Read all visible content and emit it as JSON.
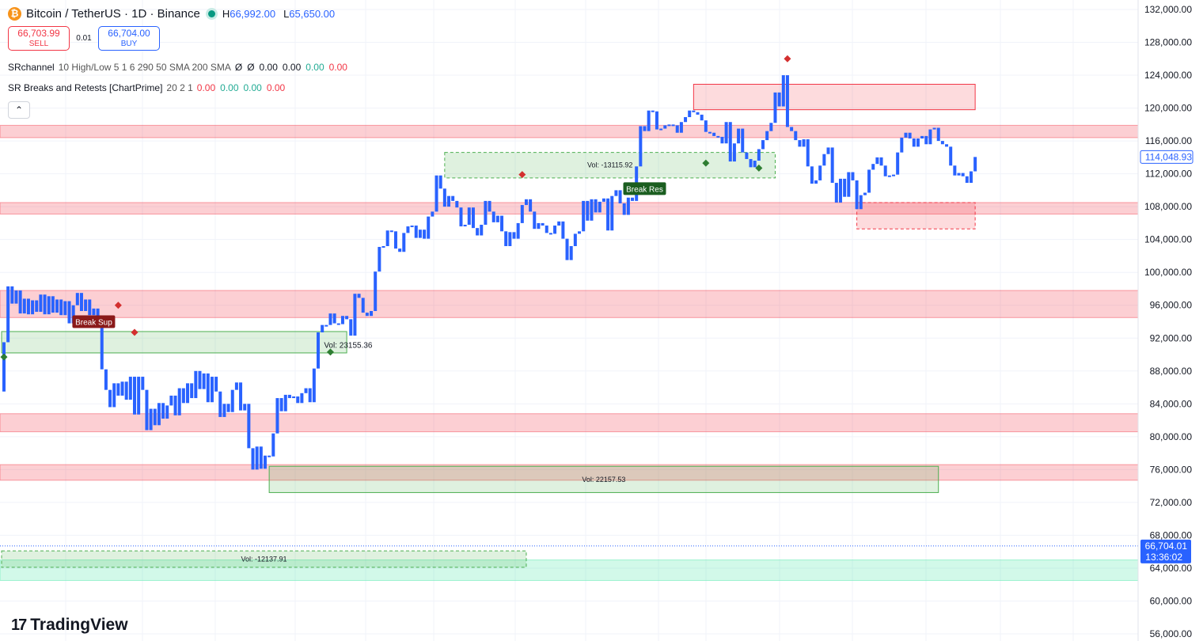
{
  "header": {
    "symbol_icon": "bitcoin-icon",
    "symbol_icon_text": "₿",
    "title": "Bitcoin / TetherUS · 1D · Binance",
    "high_label": "H",
    "high_value": "66,992.00",
    "low_label": "L",
    "low_value": "65,650.00"
  },
  "trade": {
    "sell_price": "66,703.99",
    "sell_label": "SELL",
    "spread": "0.01",
    "buy_price": "66,704.00",
    "buy_label": "BUY"
  },
  "indicators": [
    {
      "name": "SRchannel",
      "params": "10 High/Low 5 1 6 290 50 SMA 200 SMA",
      "values": [
        {
          "text": "Ø",
          "color": "#131722"
        },
        {
          "text": "Ø",
          "color": "#131722"
        },
        {
          "text": "0.00",
          "color": "#131722"
        },
        {
          "text": "0.00",
          "color": "#131722"
        },
        {
          "text": "0.00",
          "color": "#22ab94"
        },
        {
          "text": "0.00",
          "color": "#f23645"
        }
      ]
    },
    {
      "name": "SR Breaks and Retests [ChartPrime]",
      "params": "20 2 1",
      "values": [
        {
          "text": "0.00",
          "color": "#f23645"
        },
        {
          "text": "0.00",
          "color": "#22ab94"
        },
        {
          "text": "0.00",
          "color": "#22ab94"
        },
        {
          "text": "0.00",
          "color": "#f23645"
        }
      ]
    }
  ],
  "collapse_icon": "chevron-up-icon",
  "logo": {
    "mark": "17",
    "text": "TradingView"
  },
  "chart_data": {
    "type": "bar",
    "title": "Bitcoin / TetherUS · 1D · Binance",
    "bar_color": "#2962ff",
    "y_axis": {
      "ticks": [
        "132,000.00",
        "128,000.00",
        "124,000.00",
        "120,000.00",
        "116,000.00",
        "112,000.00",
        "108,000.00",
        "104,000.00",
        "100,000.00",
        "96,000.00",
        "92,000.00",
        "88,000.00",
        "84,000.00",
        "80,000.00",
        "76,000.00",
        "72,000.00",
        "68,000.00",
        "64,000.00",
        "60,000.00",
        "56,000.00"
      ],
      "ylim": [
        56000,
        132000
      ]
    },
    "last_price_label": "114,048.93",
    "current_price_label": "66,704.01",
    "countdown": "13:36:02",
    "current_price": 66704,
    "sr_zones": [
      {
        "from": 116400,
        "to": 117900,
        "color": "#f23645"
      },
      {
        "from": 107100,
        "to": 108500,
        "color": "#f23645"
      },
      {
        "from": 94500,
        "to": 97800,
        "color": "#f23645"
      },
      {
        "from": 80600,
        "to": 82800,
        "color": "#f23645"
      },
      {
        "from": 74700,
        "to": 76600,
        "color": "#f23645"
      },
      {
        "from": 62500,
        "to": 65000,
        "color": "#42e6a4"
      }
    ],
    "retest_boxes": [
      {
        "bar_from": 0,
        "bar_to": 84,
        "from": 90200,
        "to": 92800,
        "style": "solid",
        "fill": "#4caf50",
        "label": ""
      },
      {
        "bar_from": 65,
        "bar_to": 229,
        "from": 73200,
        "to": 76400,
        "style": "solid",
        "fill": "#4caf50",
        "label": "Vol: 22157.53"
      },
      {
        "bar_from": 108,
        "bar_to": 189,
        "from": 111500,
        "to": 114600,
        "style": "dashed",
        "fill": "#4caf50",
        "label": "Vol: -13115.92"
      },
      {
        "bar_from": 0,
        "bar_to": 128,
        "from": 64100,
        "to": 66100,
        "style": "dashed",
        "fill": "#4caf50",
        "label": "Vol: -12137.91"
      },
      {
        "bar_from": 169,
        "bar_to": 238,
        "from": 119800,
        "to": 122900,
        "style": "solid",
        "fill": "#f23645",
        "label": ""
      },
      {
        "bar_from": 209,
        "bar_to": 238,
        "from": 105300,
        "to": 108500,
        "style": "dashed",
        "fill": "#f23645",
        "label": ""
      }
    ],
    "break_labels": [
      {
        "bar": 22,
        "price": 94000,
        "text": "Break Sup",
        "color": "#8b1a1a"
      },
      {
        "bar": 157,
        "price": 110200,
        "text": "Break Res",
        "color": "#1b5e20"
      }
    ],
    "vol_labels": [
      {
        "bar": 79,
        "price": 91100,
        "text": "Vol: 23155.36"
      }
    ],
    "markers": [
      {
        "bar": 28,
        "price": 96000,
        "color": "#d32f2f"
      },
      {
        "bar": 32,
        "price": 92700,
        "color": "#d32f2f"
      },
      {
        "bar": 0,
        "price": 89700,
        "color": "#2e7d32"
      },
      {
        "bar": 80,
        "price": 90300,
        "color": "#2e7d32"
      },
      {
        "bar": 127,
        "price": 111900,
        "color": "#d32f2f"
      },
      {
        "bar": 172,
        "price": 113300,
        "color": "#2e7d32"
      },
      {
        "bar": 185,
        "price": 112700,
        "color": "#2e7d32"
      },
      {
        "bar": 192,
        "price": 126000,
        "color": "#d32f2f"
      }
    ],
    "closes": [
      91500,
      98300,
      96200,
      97800,
      95000,
      96800,
      94900,
      96600,
      95200,
      97300,
      94900,
      97100,
      95100,
      96700,
      94800,
      96500,
      93800,
      96000,
      97500,
      95300,
      96700,
      94800,
      95600,
      94300,
      88200,
      85700,
      83600,
      86500,
      85000,
      86700,
      84500,
      87300,
      82700,
      87300,
      85700,
      80800,
      83400,
      81400,
      84100,
      82200,
      83800,
      85000,
      82600,
      85900,
      84100,
      86500,
      84700,
      88000,
      85800,
      87700,
      84200,
      87300,
      85500,
      82400,
      84000,
      83000,
      85700,
      86600,
      83200,
      84000,
      78600,
      76000,
      78800,
      76100,
      77700,
      77600,
      80400,
      84700,
      83100,
      85100,
      84700,
      84900,
      84100,
      85300,
      85900,
      84200,
      88300,
      92700,
      93600,
      93600,
      95000,
      93800,
      93700,
      94700,
      94300,
      92300,
      97400,
      96900,
      95100,
      94700,
      95300,
      100100,
      103100,
      103200,
      105100,
      105000,
      102900,
      102500,
      104800,
      105600,
      105700,
      104200,
      105200,
      104100,
      106800,
      107400,
      111800,
      110200,
      108000,
      109300,
      108700,
      107900,
      105600,
      105800,
      107900,
      105400,
      104500,
      105800,
      108700,
      107400,
      106100,
      106900,
      105000,
      103200,
      104900,
      104100,
      106000,
      108200,
      108900,
      107400,
      105300,
      106000,
      105700,
      104800,
      104700,
      105700,
      106200,
      104100,
      101500,
      103200,
      104700,
      105000,
      108700,
      106300,
      108900,
      107300,
      108600,
      109000,
      105100,
      109300,
      110000,
      108400,
      107000,
      109100,
      108700,
      112900,
      117800,
      117200,
      119700,
      119600,
      117400,
      117500,
      117900,
      118000,
      117900,
      117000,
      118300,
      118900,
      119700,
      119500,
      119200,
      118500,
      117100,
      117000,
      116600,
      116500,
      115700,
      118300,
      113500,
      115700,
      117500,
      114600,
      113800,
      112800,
      113600,
      115000,
      116100,
      117200,
      118200,
      121900,
      120200,
      124000,
      117700,
      117200,
      116100,
      115300,
      116200,
      112900,
      110800,
      111200,
      113000,
      114400,
      115200,
      110900,
      108500,
      111400,
      109200,
      112200,
      111200,
      107700,
      109400,
      109700,
      112500,
      113200,
      114000,
      113000,
      111700,
      111800,
      111900,
      114600,
      116400,
      117000,
      116300,
      115300,
      116300,
      116600,
      115600,
      117400,
      117600,
      116000,
      115600,
      115300,
      113000,
      111800,
      112100,
      111700,
      110900,
      112300,
      114049
    ]
  }
}
